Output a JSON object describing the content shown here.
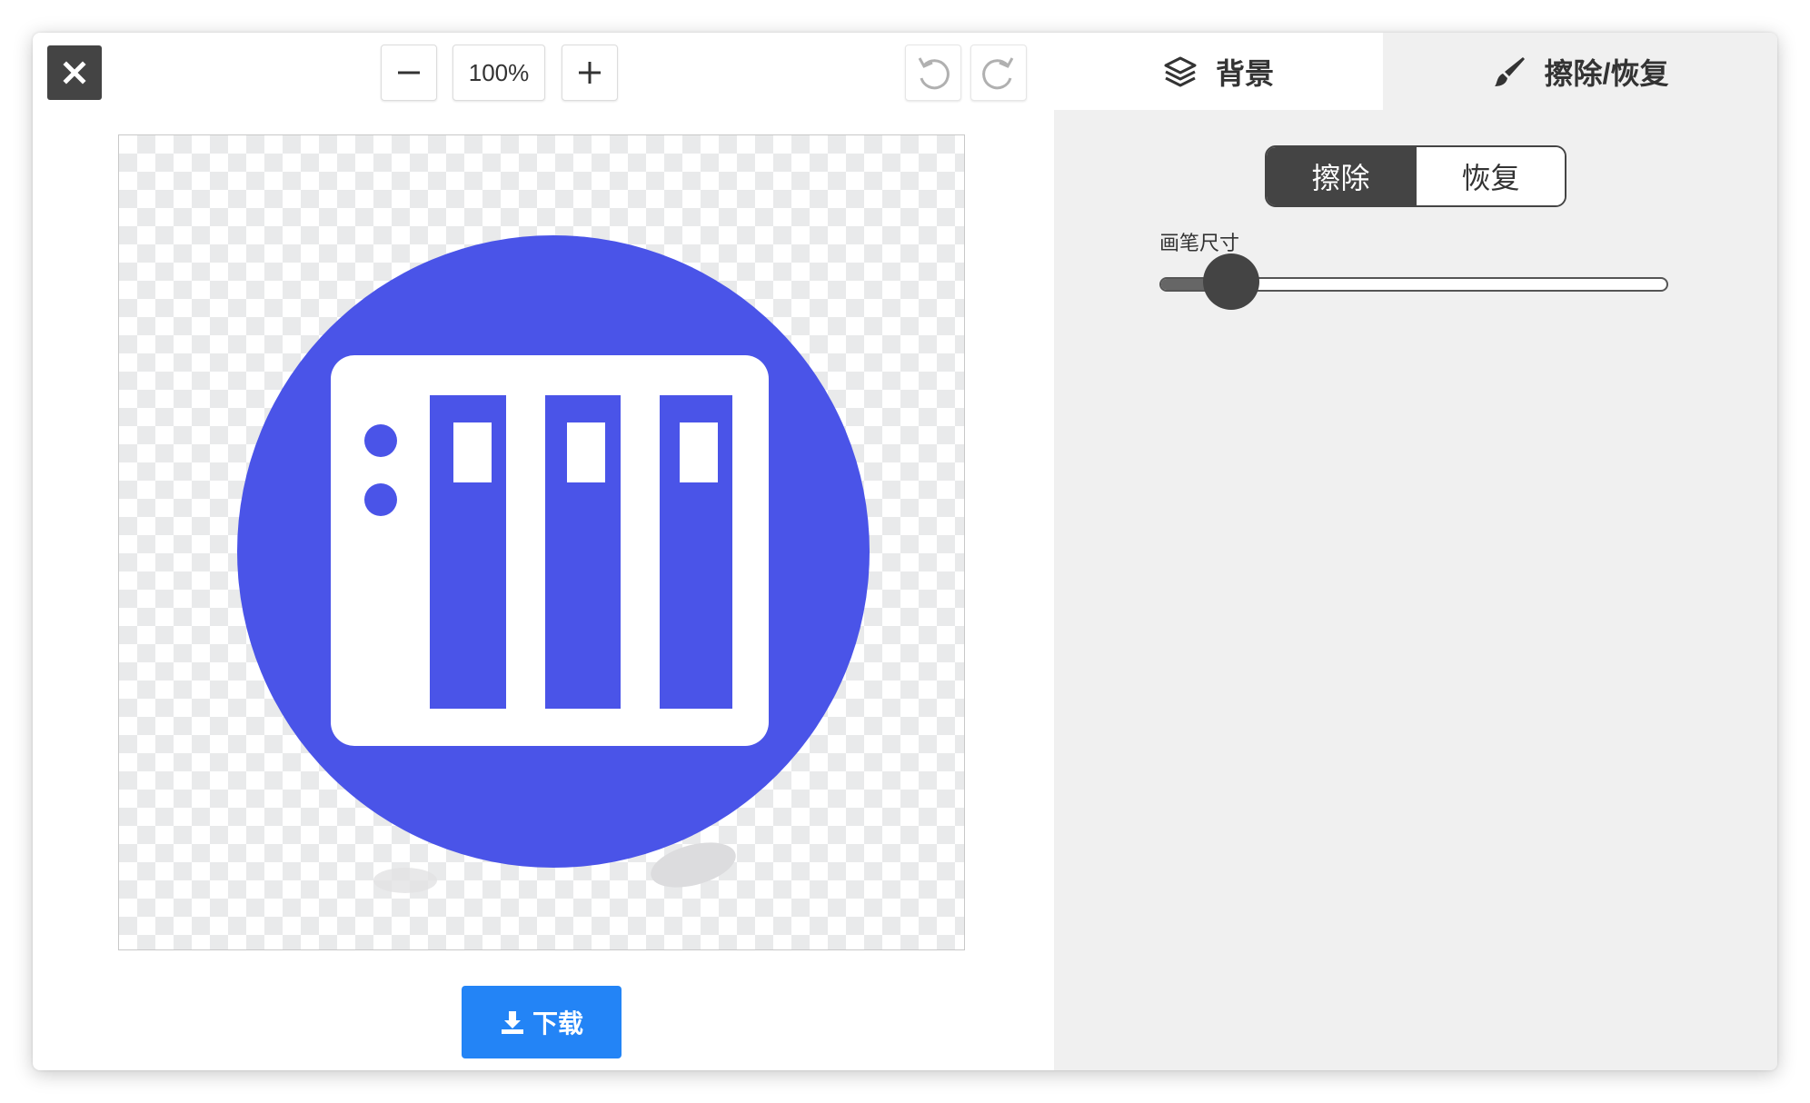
{
  "toolbar": {
    "close_icon": "close-icon",
    "zoom_out_icon": "minus-icon",
    "zoom_level": "100%",
    "zoom_in_icon": "plus-icon",
    "undo_icon": "undo-icon",
    "redo_icon": "redo-icon"
  },
  "canvas": {
    "image_icon": "server-rack-icon",
    "image_color": "#4a54e8",
    "checker_color": "#e9eaeb"
  },
  "download": {
    "label": "下载",
    "icon": "download-icon",
    "color": "#2384f6"
  },
  "tabs": [
    {
      "label": "背景",
      "icon": "layers-icon",
      "active": false
    },
    {
      "label": "擦除/恢复",
      "icon": "brush-icon",
      "active": true
    }
  ],
  "mode": {
    "options": [
      "擦除",
      "恢复"
    ],
    "selected": "擦除"
  },
  "brush": {
    "label": "画笔尺寸",
    "value_fraction": 0.12
  }
}
